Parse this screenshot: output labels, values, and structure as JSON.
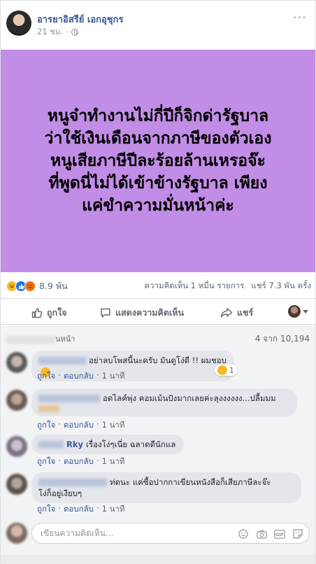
{
  "post": {
    "author": "อารยาอิสรีย์ เอกอุชุกร",
    "time": "21 ชม.",
    "text_lines": [
      "หนูจ๋าทำงานไม่กี่ปีก็จิกด่ารัฐบาล",
      "ว่าใช้เงินเดือนจากภาษีของตัวเอง",
      "หนูเสียภาษีปีละร้อยล้านเหรอจ๊ะ",
      "ที่พูดนี่ไม่ได้เข้าข้างรัฐบาล เพียง",
      "แค่ขำความมั่นหน้าค่ะ"
    ],
    "background_color": "#c28de6"
  },
  "stats": {
    "reaction_count": "8.9 พัน",
    "comments": "ความคิดเห็น 1 หมื่น รายการ",
    "shares": "แชร์ 7.3 พัน ครั้ง"
  },
  "actions": {
    "like": "ถูกใจ",
    "comment": "แสดงความคิดเห็น",
    "share": "แชร์"
  },
  "comments_header": {
    "label_suffix": "นหน้า",
    "count": "4 จาก 10,194"
  },
  "comments": [
    {
      "text": "อย่าลบโพสนี้นะครับ มันดูโง่ดี !! ผมชอบ",
      "like": "ถูกใจ",
      "reply": "ตอบกลับ",
      "time": "1 นาที",
      "reactions": "1"
    },
    {
      "text": "อดไลค์พุ่ง คอมเม้นปังมากเลยค่ะลุงงงงงง...ปลื้มมม",
      "like": "ถูกใจ",
      "reply": "ตอบกลับ",
      "time": "1 นาที"
    },
    {
      "name_tail": "Rky",
      "text": "เรื่องโง่ๆเนี่ย ฉลาดดีนักแล",
      "like": "ถูกใจ",
      "reply": "ตอบกลับ",
      "time": "1 นาที"
    },
    {
      "text_line1": "ท่ดนะ แค่ซื้อปากกาเขียนหนังสือก็เสียภาษีละจ๊ะ",
      "text_line2": "โง่ก็อยู่เงียบๆ",
      "like": "ถูกใจ",
      "reply": "ตอบกลับ",
      "time": "1 นาที"
    }
  ],
  "composer": {
    "placeholder": "เขียนความคิดเห็น..."
  },
  "icons": {
    "globe": "globe-icon",
    "like": "thumbs-up-icon",
    "comment": "comment-bubble-icon",
    "share": "share-arrow-icon",
    "emoji": "emoji-icon",
    "camera": "camera-icon",
    "gif": "gif-icon",
    "sticker": "sticker-icon"
  },
  "colors": {
    "link": "#385898",
    "meta": "#90949c",
    "like_blue": "#1877f2",
    "haha_yellow": "#f7b928",
    "angry_orange": "#e9710f"
  }
}
